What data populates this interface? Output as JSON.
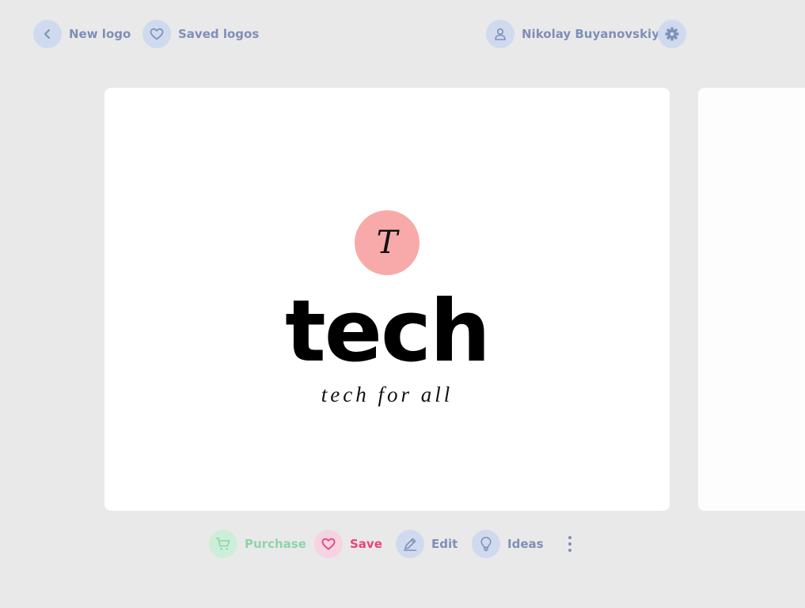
{
  "header": {
    "back_label": "New logo",
    "saved_label": "Saved logos",
    "user_name": "Nikolay Buyanovskiy",
    "icons": {
      "back": "chevron-left-icon",
      "saved": "heart-icon",
      "user": "user-icon",
      "settings": "gear-icon"
    }
  },
  "logo": {
    "mark_letter": "T",
    "name": "tech",
    "tagline": "tech for all",
    "mark_color": "#f8aaaa"
  },
  "actions": {
    "purchase_label": "Purchase",
    "save_label": "Save",
    "edit_label": "Edit",
    "ideas_label": "Ideas",
    "icons": {
      "purchase": "cart-icon",
      "save": "heart-icon",
      "edit": "pencil-icon",
      "ideas": "lightbulb-icon",
      "more": "more-vertical-icon"
    }
  },
  "colors": {
    "accent_blue": "#7f8fb8",
    "purchase_green": "#8fd4a6",
    "save_pink": "#e5457a",
    "background": "#e9e9ea"
  }
}
